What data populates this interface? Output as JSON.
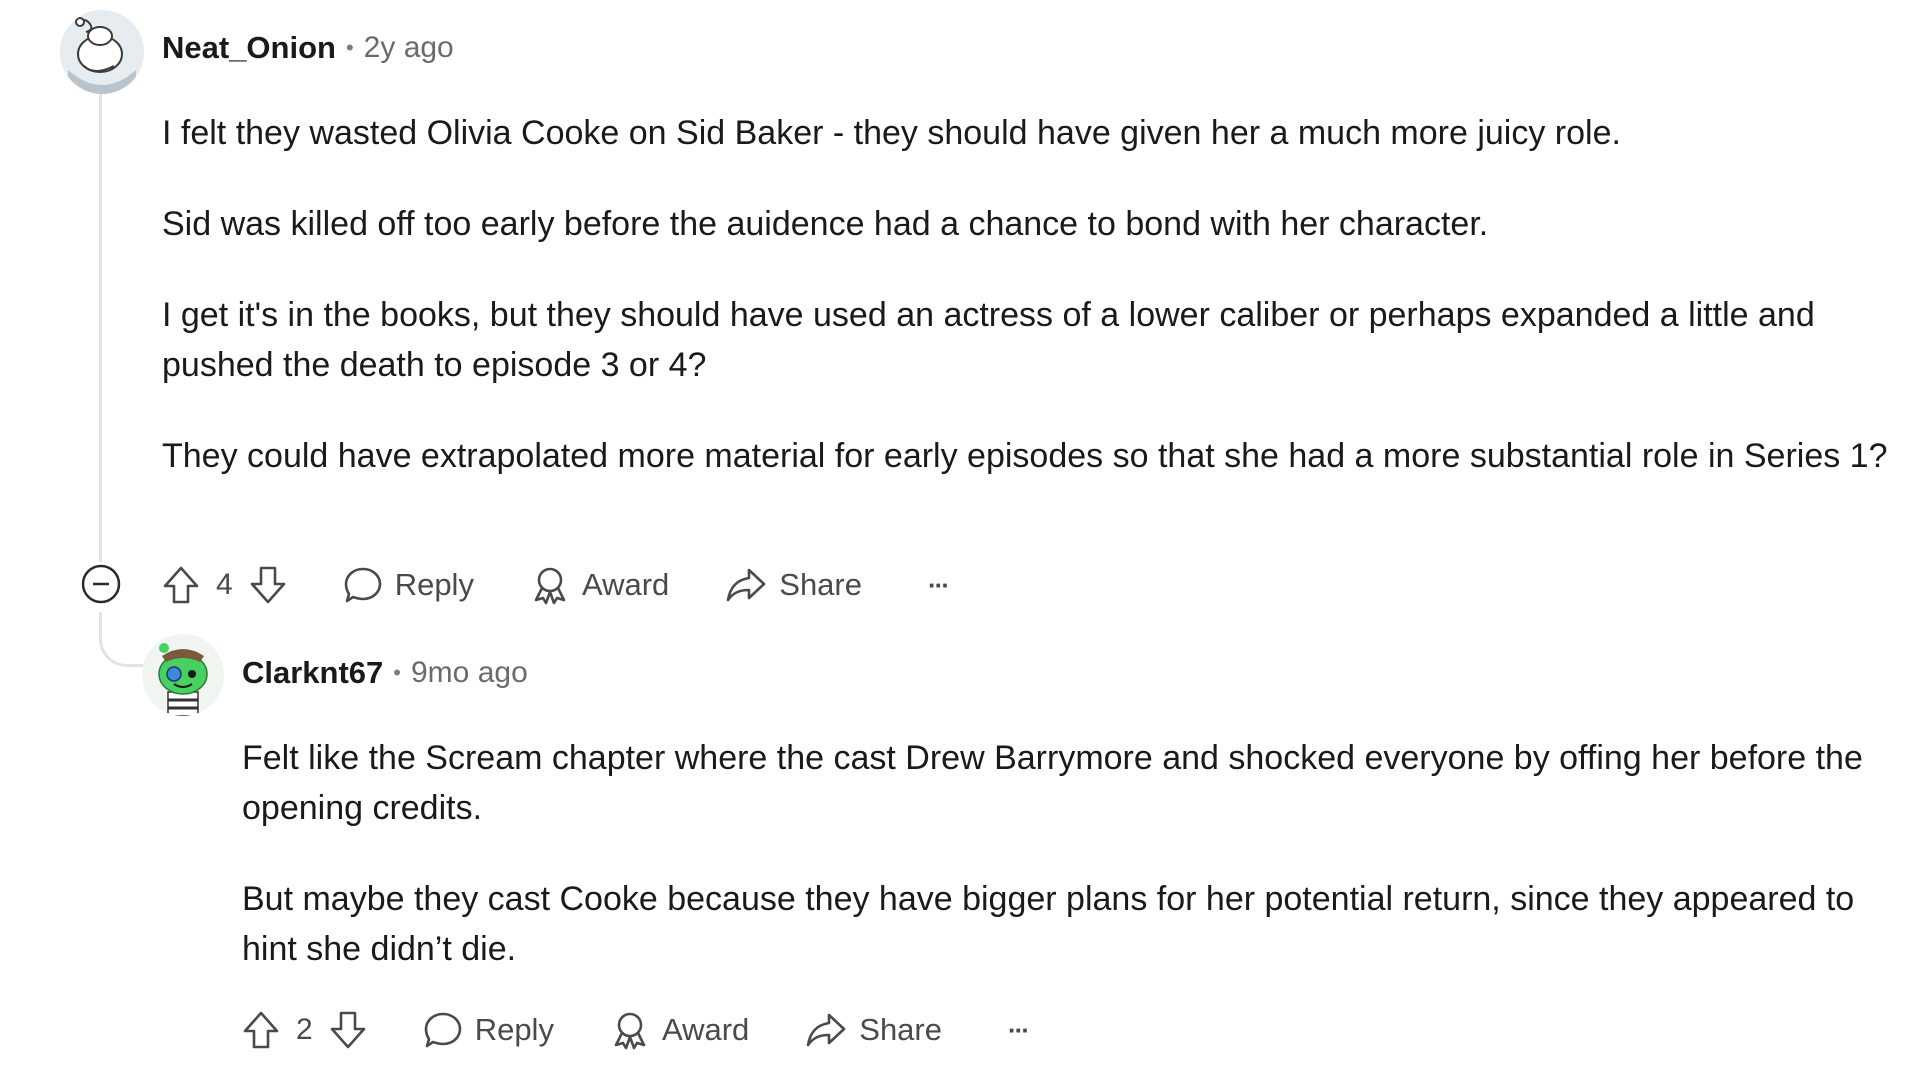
{
  "comments": [
    {
      "author": "Neat_Onion",
      "separator": "•",
      "time": "2y ago",
      "avatar_icon": "snoo-outline-avatar-icon",
      "paragraphs": [
        "I felt they wasted Olivia Cooke on Sid Baker - they should have given her a much more juicy role.",
        "Sid was killed off too early before the auidence had a chance to bond with her character.",
        "I get it's in the books, but they should have used an actress of a lower caliber or perhaps expanded a little and pushed the death to episode 3 or 4?",
        "They could have extrapolated more material for early episodes so that she had a more substantial role in Series 1?"
      ],
      "score": "4",
      "reply_label": "Reply",
      "award_label": "Award",
      "share_label": "Share",
      "more_label": "···"
    },
    {
      "author": "Clarknt67",
      "separator": "•",
      "time": "9mo ago",
      "avatar_icon": "green-snoo-avatar-icon",
      "paragraphs": [
        "Felt like the Scream chapter where the cast Drew Barrymore and shocked everyone by offing her before the opening credits.",
        "But maybe they cast Cooke because they have bigger plans for her potential return, since they appeared to hint she didn’t die."
      ],
      "score": "2",
      "reply_label": "Reply",
      "award_label": "Award",
      "share_label": "Share",
      "more_label": "···"
    }
  ],
  "colors": {
    "text": "#1a1a1b",
    "meta": "#6b6b6b",
    "action": "#4a4a4a",
    "thread_line": "#e3e3e3",
    "avatar_green": "#46d160"
  }
}
